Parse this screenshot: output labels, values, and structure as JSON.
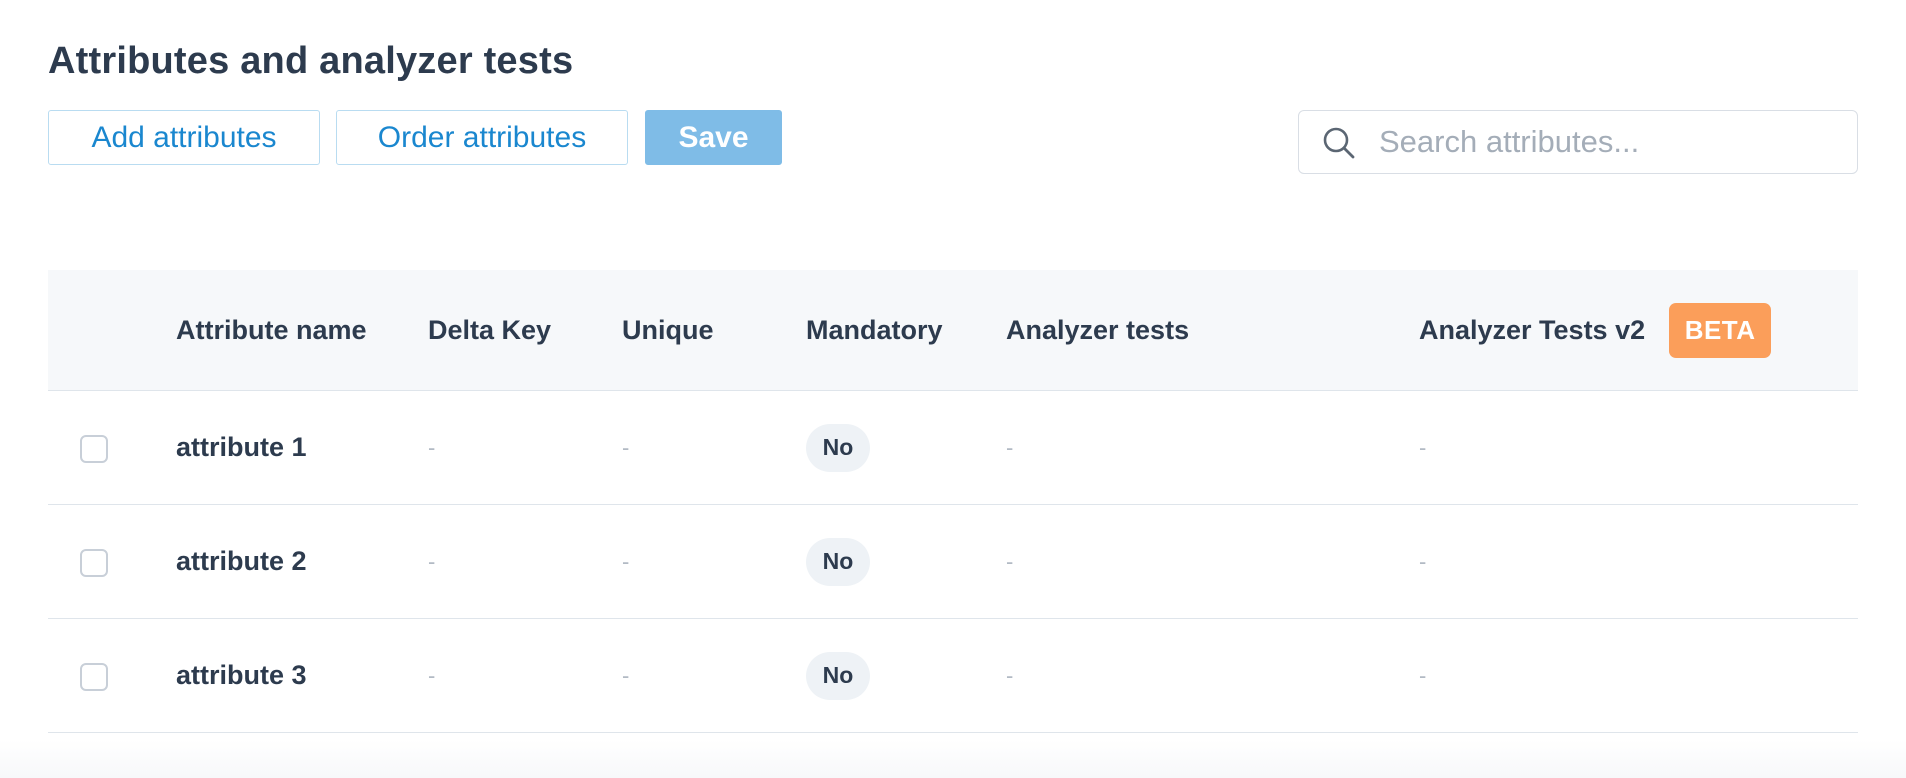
{
  "page": {
    "title": "Attributes and analyzer tests"
  },
  "toolbar": {
    "add_label": "Add attributes",
    "order_label": "Order attributes",
    "save_label": "Save"
  },
  "search": {
    "placeholder": "Search attributes...",
    "value": "",
    "icon": "search-icon"
  },
  "table": {
    "columns": [
      {
        "key": "name",
        "label": "Attribute name"
      },
      {
        "key": "delta_key",
        "label": "Delta Key"
      },
      {
        "key": "unique",
        "label": "Unique"
      },
      {
        "key": "mandatory",
        "label": "Mandatory"
      },
      {
        "key": "analyzer_tests",
        "label": "Analyzer tests"
      },
      {
        "key": "analyzer_tests_v2",
        "label": "Analyzer Tests v2"
      }
    ],
    "beta_badge": "BETA",
    "rows": [
      {
        "checked": false,
        "name": "attribute 1",
        "delta_key": "-",
        "unique": "-",
        "mandatory": "No",
        "analyzer_tests": "-",
        "analyzer_tests_v2": "-"
      },
      {
        "checked": false,
        "name": "attribute 2",
        "delta_key": "-",
        "unique": "-",
        "mandatory": "No",
        "analyzer_tests": "-",
        "analyzer_tests_v2": "-"
      },
      {
        "checked": false,
        "name": "attribute 3",
        "delta_key": "-",
        "unique": "-",
        "mandatory": "No",
        "analyzer_tests": "-",
        "analyzer_tests_v2": "-"
      }
    ]
  },
  "colors": {
    "accent": "#1a87cf",
    "save_button": "#7fbce7",
    "beta_badge": "#fb9e5a",
    "text": "#2d3b4e",
    "header_bg": "#f6f8fa"
  }
}
